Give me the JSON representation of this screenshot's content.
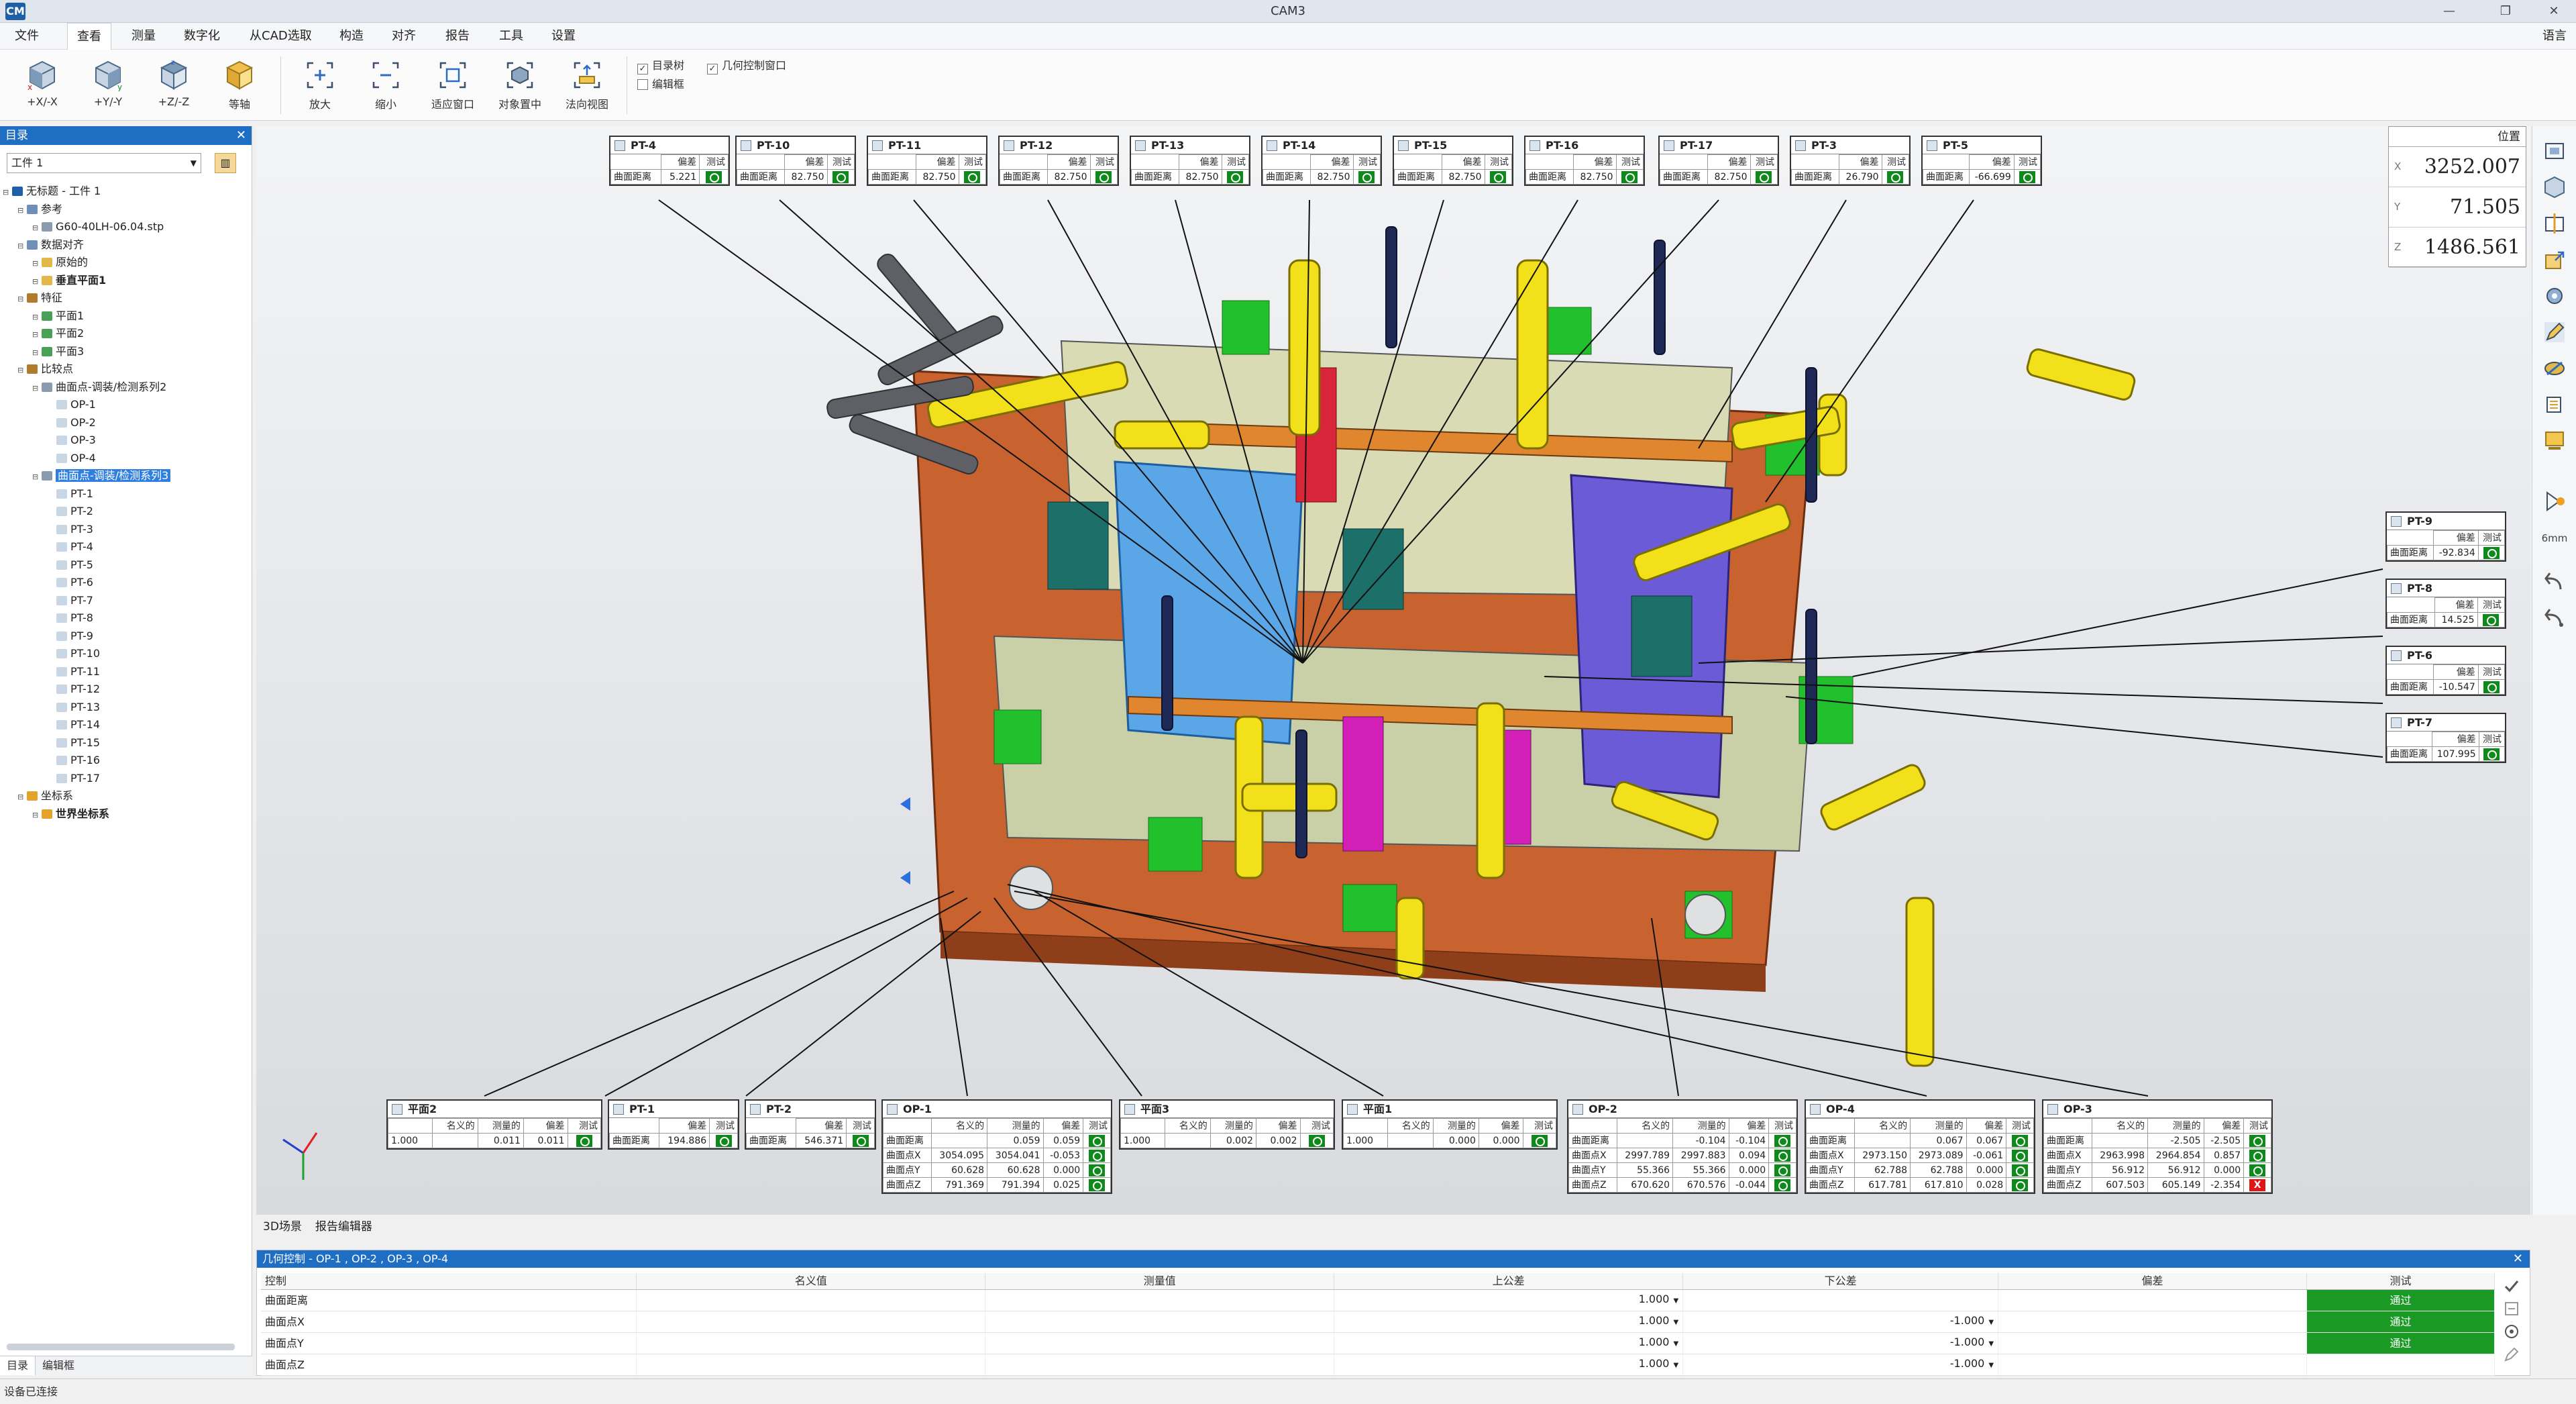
{
  "window": {
    "title": "CAM3",
    "logo": "CM",
    "minimize": "—",
    "restore": "❐",
    "close": "✕"
  },
  "menu": {
    "items": [
      "文件",
      "查看",
      "测量",
      "数字化",
      "从CAD选取",
      "构造",
      "对齐",
      "报告",
      "工具",
      "设置"
    ],
    "active_index": 1,
    "language": "语言"
  },
  "ribbon": {
    "buttons": [
      {
        "label": "+X/-X",
        "icon": "cube-x-icon"
      },
      {
        "label": "+Y/-Y",
        "icon": "cube-y-icon"
      },
      {
        "label": "+Z/-Z",
        "icon": "cube-z-icon"
      },
      {
        "label": "等轴",
        "icon": "isometric-cube-icon"
      },
      {
        "label": "放大",
        "icon": "zoom-in-icon"
      },
      {
        "label": "缩小",
        "icon": "zoom-out-icon"
      },
      {
        "label": "适应窗口",
        "icon": "fit-window-icon"
      },
      {
        "label": "对象置中",
        "icon": "center-object-icon"
      },
      {
        "label": "法向视图",
        "icon": "normal-view-icon"
      }
    ],
    "checkboxes": [
      {
        "label": "目录树",
        "checked": true
      },
      {
        "label": "几何控制窗口",
        "checked": true
      },
      {
        "label": "编辑框",
        "checked": false
      }
    ]
  },
  "left_panel": {
    "title": "目录",
    "close": "✕",
    "selector_value": "工件 1",
    "tree": [
      {
        "label": "无标题 - 工件 1",
        "level": 0,
        "icon": "project-icon",
        "color": "#1f5fa8"
      },
      {
        "label": "参考",
        "level": 1,
        "icon": "reference-icon",
        "color": "#6f8fb8"
      },
      {
        "label": "G60-40LH-06.04.stp",
        "level": 2,
        "icon": "cad-file-icon",
        "color": "#8a9bb0"
      },
      {
        "label": "数据对齐",
        "level": 1,
        "icon": "alignment-icon",
        "color": "#6f8fb8"
      },
      {
        "label": "原始的",
        "level": 2,
        "icon": "alignment-item-icon",
        "color": "#e3b84a"
      },
      {
        "label": "垂直平面1",
        "level": 2,
        "icon": "alignment-item-icon",
        "color": "#e3b84a",
        "bold": true
      },
      {
        "label": "特征",
        "level": 1,
        "icon": "feature-icon",
        "color": "#b07b2a"
      },
      {
        "label": "平面1",
        "level": 2,
        "icon": "plane-icon",
        "color": "#49a157"
      },
      {
        "label": "平面2",
        "level": 2,
        "icon": "plane-icon",
        "color": "#49a157"
      },
      {
        "label": "平面3",
        "level": 2,
        "icon": "plane-icon",
        "color": "#49a157"
      },
      {
        "label": "比较点",
        "level": 1,
        "icon": "compare-points-icon",
        "color": "#b07b2a"
      },
      {
        "label": "曲面点-调装/检测系列2",
        "level": 2,
        "icon": "point-group-icon",
        "color": "#8a9bb0"
      },
      {
        "label": "OP-1",
        "level": 3,
        "icon": "point-icon",
        "color": "#c9d6e3"
      },
      {
        "label": "OP-2",
        "level": 3,
        "icon": "point-icon",
        "color": "#c9d6e3"
      },
      {
        "label": "OP-3",
        "level": 3,
        "icon": "point-icon",
        "color": "#c9d6e3"
      },
      {
        "label": "OP-4",
        "level": 3,
        "icon": "point-icon",
        "color": "#c9d6e3"
      },
      {
        "label": "曲面点-调装/检测系列3",
        "level": 2,
        "icon": "point-group-icon",
        "color": "#8a9bb0",
        "selected": true
      },
      {
        "label": "PT-1",
        "level": 3,
        "icon": "point-icon",
        "color": "#c9d6e3"
      },
      {
        "label": "PT-2",
        "level": 3,
        "icon": "point-icon",
        "color": "#c9d6e3"
      },
      {
        "label": "PT-3",
        "level": 3,
        "icon": "point-icon",
        "color": "#c9d6e3"
      },
      {
        "label": "PT-4",
        "level": 3,
        "icon": "point-icon",
        "color": "#c9d6e3"
      },
      {
        "label": "PT-5",
        "level": 3,
        "icon": "point-icon",
        "color": "#c9d6e3"
      },
      {
        "label": "PT-6",
        "level": 3,
        "icon": "point-icon",
        "color": "#c9d6e3"
      },
      {
        "label": "PT-7",
        "level": 3,
        "icon": "point-icon",
        "color": "#c9d6e3"
      },
      {
        "label": "PT-8",
        "level": 3,
        "icon": "point-icon",
        "color": "#c9d6e3"
      },
      {
        "label": "PT-9",
        "level": 3,
        "icon": "point-icon",
        "color": "#c9d6e3"
      },
      {
        "label": "PT-10",
        "level": 3,
        "icon": "point-icon",
        "color": "#c9d6e3"
      },
      {
        "label": "PT-11",
        "level": 3,
        "icon": "point-icon",
        "color": "#c9d6e3"
      },
      {
        "label": "PT-12",
        "level": 3,
        "icon": "point-icon",
        "color": "#c9d6e3"
      },
      {
        "label": "PT-13",
        "level": 3,
        "icon": "point-icon",
        "color": "#c9d6e3"
      },
      {
        "label": "PT-14",
        "level": 3,
        "icon": "point-icon",
        "color": "#c9d6e3"
      },
      {
        "label": "PT-15",
        "level": 3,
        "icon": "point-icon",
        "color": "#c9d6e3"
      },
      {
        "label": "PT-16",
        "level": 3,
        "icon": "point-icon",
        "color": "#c9d6e3"
      },
      {
        "label": "PT-17",
        "level": 3,
        "icon": "point-icon",
        "color": "#c9d6e3"
      },
      {
        "label": "坐标系",
        "level": 1,
        "icon": "coordinate-system-icon",
        "color": "#e3a32a"
      },
      {
        "label": "世界坐标系",
        "level": 2,
        "icon": "world-coordinate-icon",
        "color": "#e3a32a",
        "bold": true
      }
    ],
    "tabs": [
      "目录",
      "编辑框"
    ]
  },
  "viewport": {
    "position_box": {
      "title": "位置",
      "x_label": "X",
      "y_label": "Y",
      "z_label": "Z",
      "x": "3252.007",
      "y": "71.505",
      "z": "1486.561"
    },
    "callouts_top": [
      {
        "name": "PT-4",
        "dev_label": "偏差",
        "test_label": "测试",
        "row_label": "曲面距离",
        "value": "5.221"
      },
      {
        "name": "PT-10",
        "dev_label": "偏差",
        "test_label": "测试",
        "row_label": "曲面距离",
        "value": "82.750"
      },
      {
        "name": "PT-11",
        "dev_label": "偏差",
        "test_label": "测试",
        "row_label": "曲面距离",
        "value": "82.750"
      },
      {
        "name": "PT-12",
        "dev_label": "偏差",
        "test_label": "测试",
        "row_label": "曲面距离",
        "value": "82.750"
      },
      {
        "name": "PT-13",
        "dev_label": "偏差",
        "test_label": "测试",
        "row_label": "曲面距离",
        "value": "82.750"
      },
      {
        "name": "PT-14",
        "dev_label": "偏差",
        "test_label": "测试",
        "row_label": "曲面距离",
        "value": "82.750"
      },
      {
        "name": "PT-15",
        "dev_label": "偏差",
        "test_label": "测试",
        "row_label": "曲面距离",
        "value": "82.750"
      },
      {
        "name": "PT-16",
        "dev_label": "偏差",
        "test_label": "测试",
        "row_label": "曲面距离",
        "value": "82.750"
      },
      {
        "name": "PT-17",
        "dev_label": "偏差",
        "test_label": "测试",
        "row_label": "曲面距离",
        "value": "82.750"
      },
      {
        "name": "PT-3",
        "dev_label": "偏差",
        "test_label": "测试",
        "row_label": "曲面距离",
        "value": "26.790"
      },
      {
        "name": "PT-5",
        "dev_label": "偏差",
        "test_label": "测试",
        "row_label": "曲面距离",
        "value": "-66.699"
      }
    ],
    "callouts_right": [
      {
        "name": "PT-9",
        "dev_label": "偏差",
        "test_label": "测试",
        "row_label": "曲面距离",
        "value": "-92.834"
      },
      {
        "name": "PT-8",
        "dev_label": "偏差",
        "test_label": "测试",
        "row_label": "曲面距离",
        "value": "14.525"
      },
      {
        "name": "PT-6",
        "dev_label": "偏差",
        "test_label": "测试",
        "row_label": "曲面距离",
        "value": "-10.547"
      },
      {
        "name": "PT-7",
        "dev_label": "偏差",
        "test_label": "测试",
        "row_label": "曲面距离",
        "value": "107.995"
      }
    ],
    "plane_callouts": [
      {
        "name": "平面2",
        "h1": "名义的",
        "h2": "测量的",
        "h3": "偏差",
        "h4": "测试",
        "v0": "1.000",
        "v1": "",
        "v2": "0.011",
        "v3": "0.011"
      },
      {
        "name": "平面3",
        "h1": "名义的",
        "h2": "测量的",
        "h3": "偏差",
        "h4": "测试",
        "v0": "1.000",
        "v1": "",
        "v2": "0.002",
        "v3": "0.002"
      },
      {
        "name": "平面1",
        "h1": "名义的",
        "h2": "测量的",
        "h3": "偏差",
        "h4": "测试",
        "v0": "1.000",
        "v1": "",
        "v2": "0.000",
        "v3": "0.000"
      }
    ],
    "pt_bottom": [
      {
        "name": "PT-1",
        "dev_label": "偏差",
        "test_label": "测试",
        "row_label": "曲面距离",
        "value": "194.886"
      },
      {
        "name": "PT-2",
        "dev_label": "偏差",
        "test_label": "测试",
        "row_label": "曲面距离",
        "value": "546.371"
      }
    ],
    "op_callouts": [
      {
        "name": "OP-1",
        "h1": "名义的",
        "h2": "测量的",
        "h3": "偏差",
        "h4": "测试",
        "rows": [
          {
            "label": "曲面距离",
            "nominal": "",
            "measured": "0.059",
            "dev": "0.059",
            "ok": true
          },
          {
            "label": "曲面点X",
            "nominal": "3054.095",
            "measured": "3054.041",
            "dev": "-0.053",
            "ok": true
          },
          {
            "label": "曲面点Y",
            "nominal": "60.628",
            "measured": "60.628",
            "dev": "0.000",
            "ok": true
          },
          {
            "label": "曲面点Z",
            "nominal": "791.369",
            "measured": "791.394",
            "dev": "0.025",
            "ok": true
          }
        ]
      },
      {
        "name": "OP-2",
        "h1": "名义的",
        "h2": "测量的",
        "h3": "偏差",
        "h4": "测试",
        "rows": [
          {
            "label": "曲面距离",
            "nominal": "",
            "measured": "-0.104",
            "dev": "-0.104",
            "ok": true
          },
          {
            "label": "曲面点X",
            "nominal": "2997.789",
            "measured": "2997.883",
            "dev": "0.094",
            "ok": true
          },
          {
            "label": "曲面点Y",
            "nominal": "55.366",
            "measured": "55.366",
            "dev": "0.000",
            "ok": true
          },
          {
            "label": "曲面点Z",
            "nominal": "670.620",
            "measured": "670.576",
            "dev": "-0.044",
            "ok": true
          }
        ]
      },
      {
        "name": "OP-4",
        "h1": "名义的",
        "h2": "测量的",
        "h3": "偏差",
        "h4": "测试",
        "rows": [
          {
            "label": "曲面距离",
            "nominal": "",
            "measured": "0.067",
            "dev": "0.067",
            "ok": true
          },
          {
            "label": "曲面点X",
            "nominal": "2973.150",
            "measured": "2973.089",
            "dev": "-0.061",
            "ok": true
          },
          {
            "label": "曲面点Y",
            "nominal": "62.788",
            "measured": "62.788",
            "dev": "0.000",
            "ok": true
          },
          {
            "label": "曲面点Z",
            "nominal": "617.781",
            "measured": "617.810",
            "dev": "0.028",
            "ok": true
          }
        ]
      },
      {
        "name": "OP-3",
        "h1": "名义的",
        "h2": "测量的",
        "h3": "偏差",
        "h4": "测试",
        "rows": [
          {
            "label": "曲面距离",
            "nominal": "",
            "measured": "-2.505",
            "dev": "-2.505",
            "ok": true
          },
          {
            "label": "曲面点X",
            "nominal": "2963.998",
            "measured": "2964.854",
            "dev": "0.857",
            "ok": true
          },
          {
            "label": "曲面点Y",
            "nominal": "56.912",
            "measured": "56.912",
            "dev": "0.000",
            "ok": true
          },
          {
            "label": "曲面点Z",
            "nominal": "607.503",
            "measured": "605.149",
            "dev": "-2.354",
            "ok": false
          }
        ]
      }
    ],
    "fail_mark": "X"
  },
  "right_toolbar": {
    "distance_label": "6mm"
  },
  "view_tabs": [
    "3D场景",
    "报告编辑器"
  ],
  "bottom_panel": {
    "title": "几何控制 - OP-1 , OP-2 , OP-3 , OP-4",
    "close": "✕",
    "headers": [
      "控制",
      "名义值",
      "测量值",
      "上公差",
      "下公差",
      "偏差",
      "测试"
    ],
    "rows": [
      {
        "control": "曲面距离",
        "nominal": "",
        "measured": "",
        "upper": "1.000",
        "lower": "",
        "dev": "",
        "test": "通过"
      },
      {
        "control": "曲面点X",
        "nominal": "",
        "measured": "",
        "upper": "1.000",
        "lower": "-1.000",
        "dev": "",
        "test": "通过"
      },
      {
        "control": "曲面点Y",
        "nominal": "",
        "measured": "",
        "upper": "1.000",
        "lower": "-1.000",
        "dev": "",
        "test": "通过"
      },
      {
        "control": "曲面点Z",
        "nominal": "",
        "measured": "",
        "upper": "1.000",
        "lower": "-1.000",
        "dev": "",
        "test": ""
      }
    ]
  },
  "status": {
    "text": "设备已连接"
  }
}
